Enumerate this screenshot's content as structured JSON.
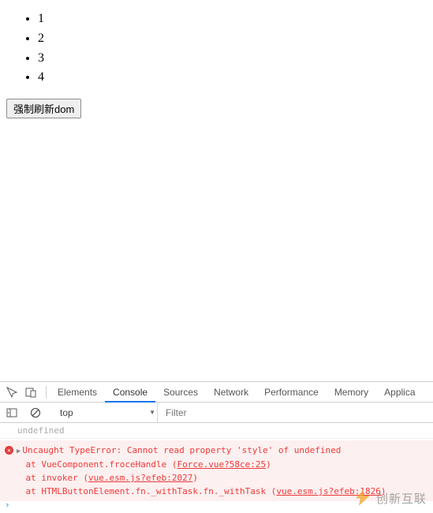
{
  "list_items": [
    "1",
    "2",
    "3",
    "4"
  ],
  "button_label": "强制刷新dom",
  "devtools": {
    "tabs": [
      "Elements",
      "Console",
      "Sources",
      "Network",
      "Performance",
      "Memory",
      "Applica"
    ],
    "active_tab": "Console",
    "context_selector": "top",
    "filter_placeholder": "Filter",
    "console": {
      "undefined_line": "undefined",
      "error": {
        "message": "Uncaught TypeError: Cannot read property 'style' of undefined",
        "stack": [
          {
            "prefix": "    at VueComponent.froceHandle (",
            "link": "Force.vue?58ce:25",
            "suffix": ")"
          },
          {
            "prefix": "    at invoker (",
            "link": "vue.esm.js?efeb:2027",
            "suffix": ")"
          },
          {
            "prefix": "    at HTMLButtonElement.fn._withTask.fn._withTask (",
            "link": "vue.esm.js?efeb:1826",
            "suffix": ")"
          }
        ]
      }
    }
  },
  "watermark_text": "创新互联"
}
